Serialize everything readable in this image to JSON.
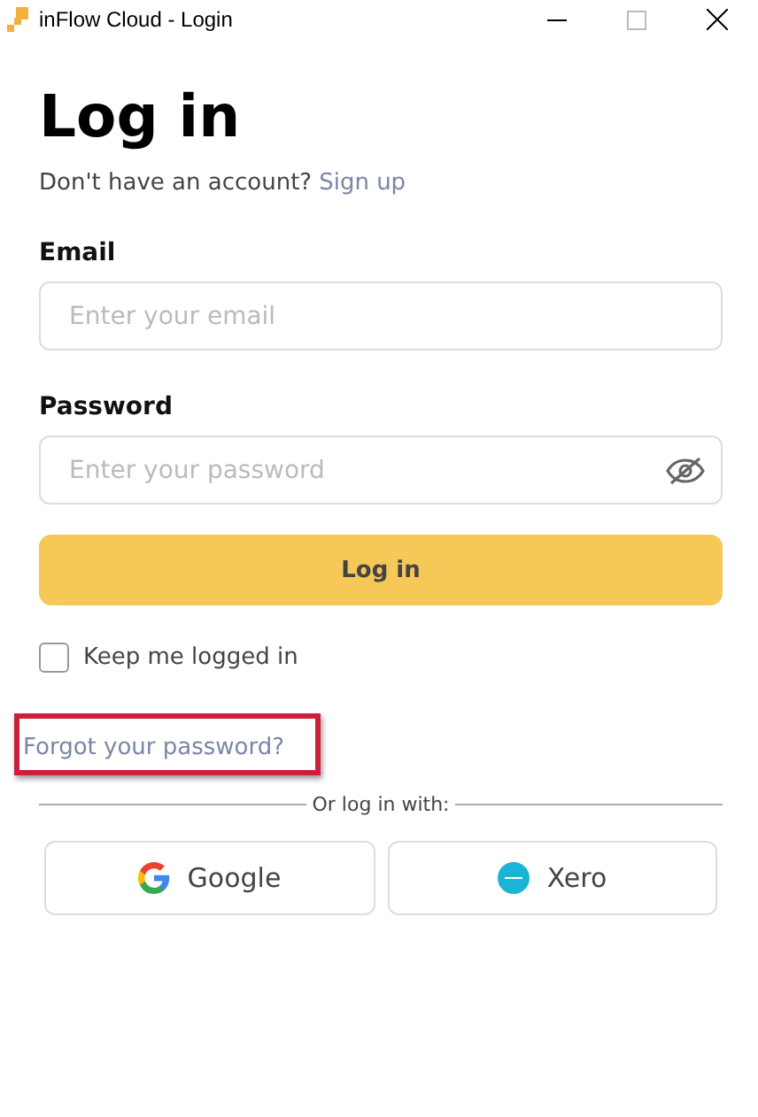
{
  "window": {
    "title": "inFlow Cloud - Login"
  },
  "heading": "Log in",
  "signup": {
    "prompt": "Don't have an account?",
    "link": "Sign up"
  },
  "fields": [
    {
      "label": "Email",
      "placeholder": "Enter your email",
      "kind": "text"
    },
    {
      "label": "Password",
      "placeholder": "Enter your password",
      "kind": "password"
    }
  ],
  "submit": "Log in",
  "remember": {
    "label": "Keep me logged in",
    "checked": false
  },
  "forgot": {
    "label": "Forgot your password?",
    "highlighted": true
  },
  "divider": "Or log in with:",
  "providers": [
    {
      "label": "Google",
      "kind": "google"
    },
    {
      "label": "Xero",
      "kind": "xero"
    }
  ]
}
